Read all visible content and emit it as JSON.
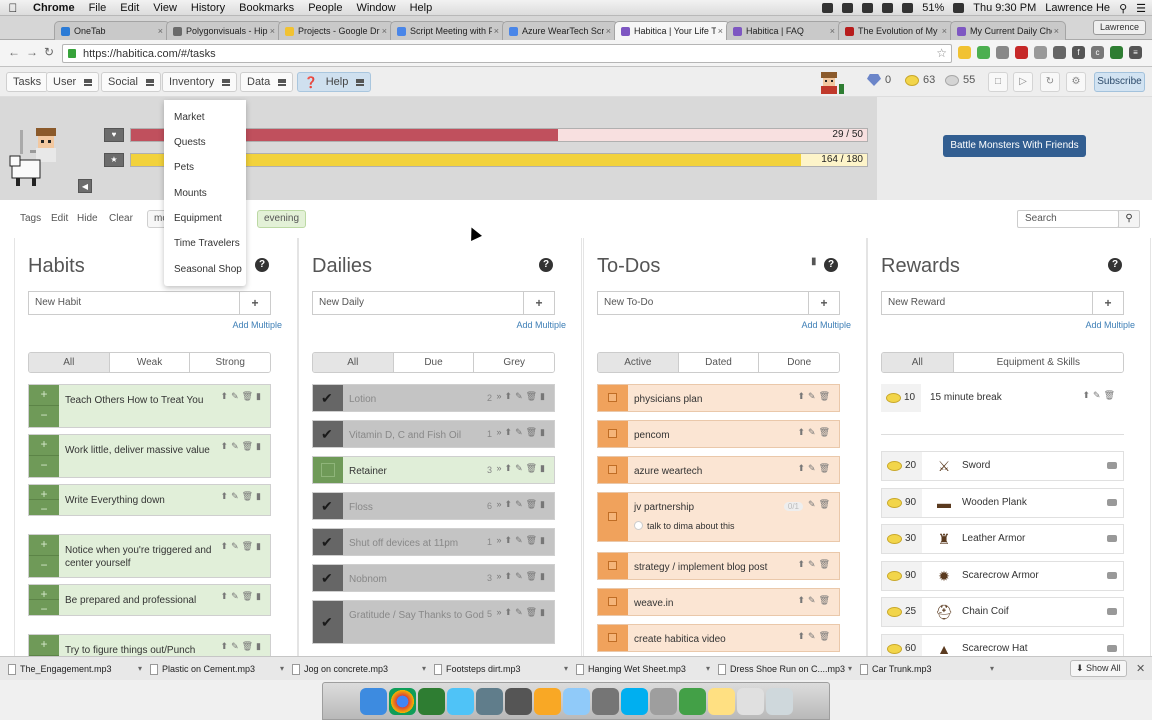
{
  "macos": {
    "app": "Chrome",
    "menus": [
      "File",
      "Edit",
      "View",
      "History",
      "Bookmarks",
      "People",
      "Window",
      "Help"
    ],
    "battery": "51%",
    "clock": "Thu 9:30 PM",
    "user": "Lawrence He"
  },
  "browser": {
    "tabs": [
      {
        "title": "OneTab",
        "color": "#2b7bd6",
        "active": false
      },
      {
        "title": "Polygonvisuals - Hipl...",
        "color": "#6a6a6a",
        "active": false
      },
      {
        "title": "Projects - Google Dri...",
        "color": "#f1c232",
        "active": false
      },
      {
        "title": "Script Meeting with F...",
        "color": "#4a86e8",
        "active": false
      },
      {
        "title": "Azure WearTech Scri...",
        "color": "#4a86e8",
        "active": false
      },
      {
        "title": "Habitica | Your Life T...",
        "color": "#7e57c2",
        "active": true
      },
      {
        "title": "Habitica | FAQ",
        "color": "#7e57c2",
        "active": false
      },
      {
        "title": "The Evolution of My T...",
        "color": "#b71c1c",
        "active": false
      },
      {
        "title": "My Current Daily Che...",
        "color": "#7e57c2",
        "active": false
      }
    ],
    "profile": "Lawrence",
    "url": "https://habitica.com/#/tasks"
  },
  "nav": {
    "items": [
      "Tasks",
      "User",
      "Social",
      "Inventory",
      "Data",
      "Help"
    ],
    "gems": "0",
    "gold": "63",
    "silver": "55",
    "subscribe": "Subscribe"
  },
  "inventory_menu": [
    "Market",
    "Quests",
    "Pets",
    "Mounts",
    "Equipment",
    "Time Travelers",
    "Seasonal Shop"
  ],
  "stats": {
    "hp_text": "29 / 50",
    "hp_fraction": 0.58,
    "xp_text": "164 / 180",
    "xp_fraction": 0.911,
    "battle": "Battle Monsters With Friends"
  },
  "filters": {
    "labels": [
      "Tags",
      "Edit",
      "Hide",
      "Clear"
    ],
    "tags": [
      "mo",
      "evening"
    ],
    "search_placeholder": "Search"
  },
  "habits": {
    "title": "Habits",
    "new_placeholder": "New Habit",
    "add_multiple": "Add Multiple",
    "tabs": [
      "All",
      "Weak",
      "Strong"
    ],
    "items": [
      "Teach Others How to Treat You",
      "Work little, deliver massive value",
      "Write Everything down",
      "Notice when you're triggered and center yourself",
      "Be prepared and professional",
      "Try to figure things out/Punch"
    ]
  },
  "dailies": {
    "title": "Dailies",
    "new_placeholder": "New Daily",
    "add_multiple": "Add Multiple",
    "tabs": [
      "All",
      "Due",
      "Grey"
    ],
    "items": [
      {
        "text": "Lotion",
        "streak": "2",
        "done": true
      },
      {
        "text": "Vitamin D, C and Fish Oil",
        "streak": "1",
        "done": true
      },
      {
        "text": "Retainer",
        "streak": "3",
        "done": false
      },
      {
        "text": "Floss",
        "streak": "6",
        "done": true
      },
      {
        "text": "Shut off devices at 11pm",
        "streak": "1",
        "done": true
      },
      {
        "text": "Nobnom",
        "streak": "3",
        "done": true
      },
      {
        "text": "Gratitude / Say Thanks to God",
        "streak": "5",
        "done": true
      }
    ]
  },
  "todos": {
    "title": "To-Dos",
    "new_placeholder": "New To-Do",
    "add_multiple": "Add Multiple",
    "tabs": [
      "Active",
      "Dated",
      "Done"
    ],
    "items": [
      {
        "text": "physicians plan"
      },
      {
        "text": "pencom"
      },
      {
        "text": "azure weartech"
      },
      {
        "text": "jv partnership",
        "sub": "talk to dima about this",
        "progress": "0/1"
      },
      {
        "text": "strategy / implement blog post"
      },
      {
        "text": "weave.in"
      },
      {
        "text": "create habitica video"
      }
    ]
  },
  "rewards": {
    "title": "Rewards",
    "new_placeholder": "New Reward",
    "add_multiple": "Add Multiple",
    "tabs": [
      "All",
      "Equipment & Skills"
    ],
    "custom": [
      {
        "price": "10",
        "text": "15 minute break"
      }
    ],
    "items": [
      {
        "price": "20",
        "text": "Sword",
        "icon": "sword-icon"
      },
      {
        "price": "90",
        "text": "Wooden Plank",
        "icon": "plank-icon"
      },
      {
        "price": "30",
        "text": "Leather Armor",
        "icon": "armor-icon"
      },
      {
        "price": "90",
        "text": "Scarecrow Armor",
        "icon": "scarecrow-armor-icon"
      },
      {
        "price": "25",
        "text": "Chain Coif",
        "icon": "coif-icon"
      },
      {
        "price": "60",
        "text": "Scarecrow Hat",
        "icon": "hat-icon"
      }
    ]
  },
  "downloads": {
    "files": [
      "The_Engagement.mp3",
      "Plastic on Cement.mp3",
      "Jog on concrete.mp3",
      "Footsteps dirt.mp3",
      "Hanging Wet Sheet.mp3",
      "Dress Shoe Run on C....mp3",
      "Car Trunk.mp3"
    ],
    "show_all": "Show All"
  },
  "colors": {
    "hp": "#c0505d",
    "xp": "#f2d23c",
    "habit": "#6f9a58",
    "todo": "#f0a25c",
    "battle": "#325e91"
  }
}
